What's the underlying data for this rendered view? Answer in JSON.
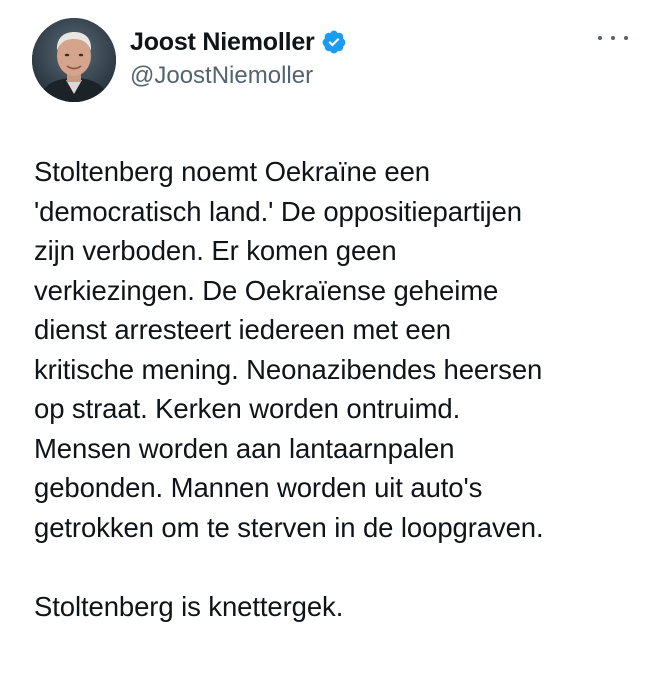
{
  "author": {
    "display_name": "Joost Niemoller",
    "handle": "@JoostNiemoller",
    "verified": true,
    "avatar_icon": "profile-photo"
  },
  "menu": {
    "icon": "more-options-icon"
  },
  "post": {
    "paragraphs": [
      "Stoltenberg noemt Oekraïne een\n'democratisch land.' De oppositiepartijen\nzijn verboden. Er komen geen\nverkiezingen. De Oekraïense geheime\ndienst arresteert iedereen met een\nkritische mening. Neonazibendes heersen\nop straat. Kerken worden ontruimd.\nMensen worden aan lantaarnpalen\ngebonden. Mannen worden uit auto's\ngetrokken om te sterven in de loopgraven.",
      "Stoltenberg is knettergek."
    ]
  },
  "colors": {
    "text": "#0f1419",
    "secondary": "#536471",
    "verified_badge": "#1d9bf0",
    "background": "#ffffff"
  }
}
